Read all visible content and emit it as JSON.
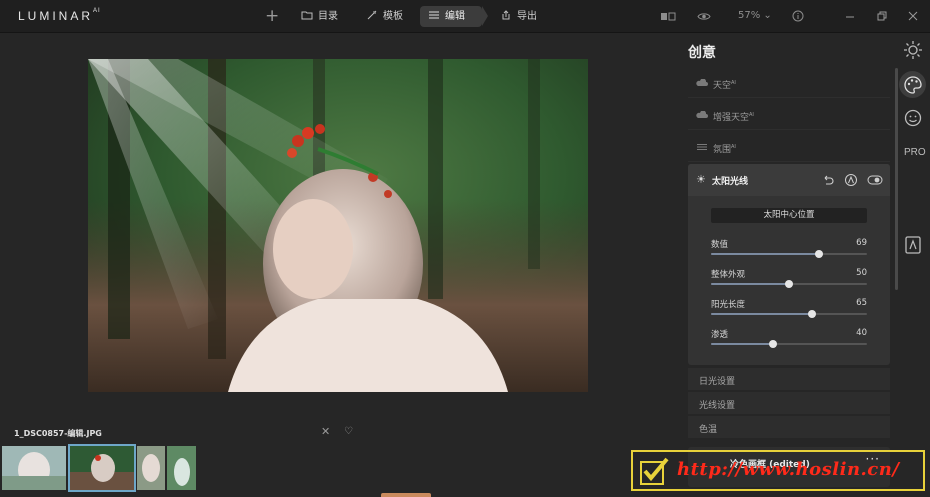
{
  "app": {
    "logo_text": "LUMINAR",
    "logo_sup": "AI"
  },
  "toolbar": {
    "add_label": "+",
    "library_label": "目录",
    "templates_label": "模板",
    "edit_label": "编辑",
    "export_label": "导出",
    "zoom_value": "57%",
    "zoom_caret": "⌄"
  },
  "photo": {
    "filename": "1_DSC0857-编辑.JPG"
  },
  "panel": {
    "title": "创意",
    "tools": [
      {
        "label": "天空",
        "ai": "AI",
        "icon": "cloud-icon"
      },
      {
        "label": "增强天空",
        "ai": "AI",
        "icon": "cloud-plus-icon"
      },
      {
        "label": "氛围",
        "ai": "AI",
        "icon": "haze-icon"
      }
    ],
    "active_tool": {
      "label": "太阳光线",
      "icon": "sun-icon",
      "position_button": "太阳中心位置",
      "sliders": [
        {
          "label": "数值",
          "value": 69
        },
        {
          "label": "整体外观",
          "value": 50
        },
        {
          "label": "阳光长度",
          "value": 65
        },
        {
          "label": "渗透",
          "value": 40
        }
      ]
    },
    "sub_sections": [
      "日光设置",
      "光线设置",
      "色温"
    ],
    "preset": {
      "label": "冷色画框 (edited)",
      "more": "···"
    }
  },
  "watermark": {
    "text": "http://www.hoslin.cn/"
  },
  "colors": {
    "accent_selected": "#6ea7c8",
    "slider_fill": "#7b8aa0",
    "bottom_tab": "#c98a5d",
    "watermark_text": "#ff2a1a",
    "watermark_border": "#e8d23a"
  }
}
